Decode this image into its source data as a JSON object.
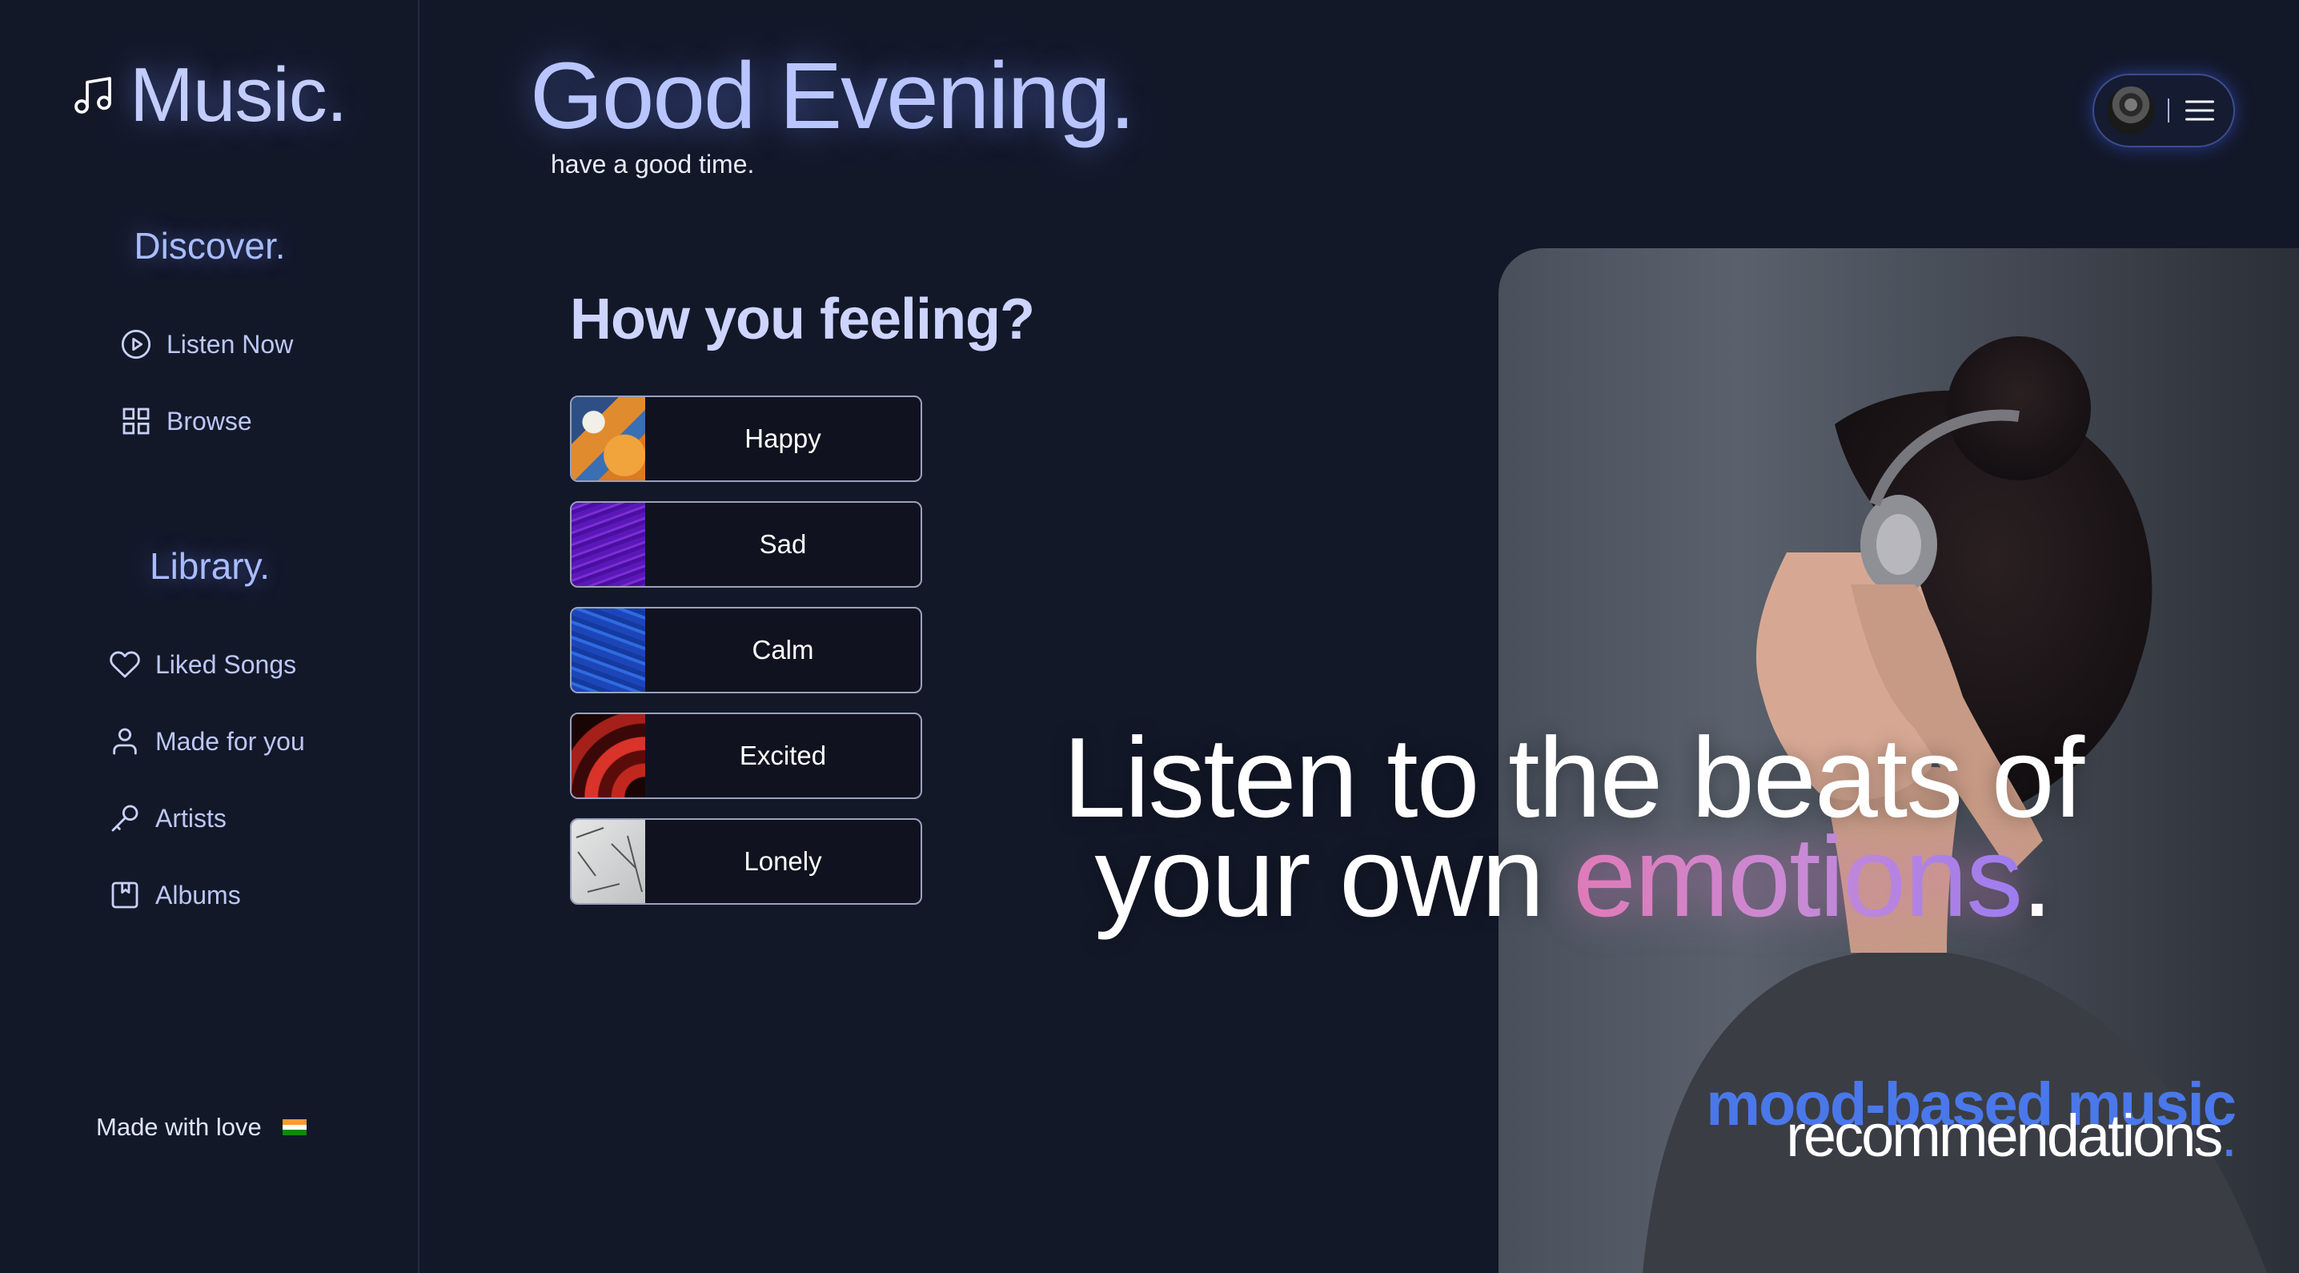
{
  "sidebar": {
    "brand": "Music.",
    "discover_title": "Discover.",
    "discover_items": [
      {
        "label": "Listen Now",
        "icon": "play-circle-icon"
      },
      {
        "label": "Browse",
        "icon": "grid-icon"
      }
    ],
    "library_title": "Library.",
    "library_items": [
      {
        "label": "Liked Songs",
        "icon": "heart-icon"
      },
      {
        "label": "Made for you",
        "icon": "user-icon"
      },
      {
        "label": "Artists",
        "icon": "microphone-icon"
      },
      {
        "label": "Albums",
        "icon": "album-icon"
      }
    ],
    "footer": "Made with love",
    "footer_flag": "india-flag-icon"
  },
  "header": {
    "greeting": "Good Evening.",
    "subgreeting": "have a good time."
  },
  "mood": {
    "title": "How you feeling?",
    "options": [
      {
        "label": "Happy"
      },
      {
        "label": "Sad"
      },
      {
        "label": "Calm"
      },
      {
        "label": "Excited"
      },
      {
        "label": "Lonely"
      }
    ]
  },
  "hero": {
    "line1": "Listen to the beats of",
    "line2_prefix": "your own ",
    "line2_highlight": "emotions",
    "line2_suffix": ".",
    "tagline_top": "mood-based music",
    "tagline_bottom": "recommendations",
    "tagline_dot": "."
  },
  "colors": {
    "background": "#131829",
    "accent_blue": "#4a78ea",
    "heading_lavender": "#b9c5ff",
    "emotion_gradient": [
      "#e07ab8",
      "#9d7cf0"
    ]
  }
}
